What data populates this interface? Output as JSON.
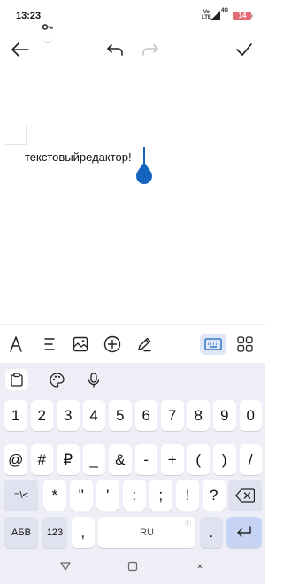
{
  "status": {
    "time": "13:23",
    "volte": [
      "Vo",
      "LTE"
    ],
    "network": "4G",
    "battery": "14"
  },
  "editor": {
    "text": "текстовыйредактор!"
  },
  "keyboard": {
    "rows": [
      [
        "1",
        "2",
        "3",
        "4",
        "5",
        "6",
        "7",
        "8",
        "9",
        "0"
      ],
      [
        "@",
        "#",
        "₽",
        "_",
        "&",
        "-",
        "+",
        "(",
        ")",
        "/"
      ],
      [
        "=\\<",
        "*",
        "\"",
        "'",
        ":",
        ";",
        "!",
        "?"
      ]
    ],
    "bottom": {
      "lang_switch": "АБВ",
      "numeric": "123",
      "comma": ",",
      "space": "RU",
      "period": "."
    }
  },
  "colors": {
    "accent": "#1565c0",
    "keyboard_bg": "#eeeef6",
    "battery": "#e46a72"
  }
}
